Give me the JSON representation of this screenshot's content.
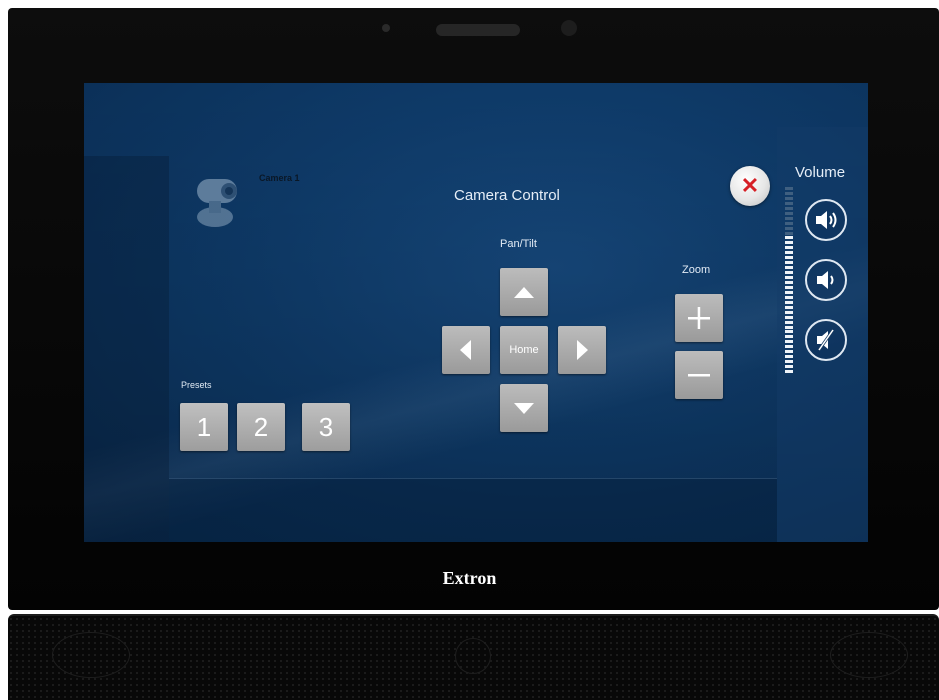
{
  "device": {
    "brand": "Extron"
  },
  "screen": {
    "camera_label": "Camera 1",
    "title": "Camera Control",
    "close_icon": "close-icon",
    "pan_tilt": {
      "label": "Pan/Tilt",
      "home_label": "Home"
    },
    "zoom": {
      "label": "Zoom"
    },
    "presets": {
      "label": "Presets",
      "items": [
        "1",
        "2",
        "3"
      ]
    },
    "volume": {
      "label": "Volume",
      "level": 0.73,
      "buttons": [
        "volume-up-icon",
        "volume-down-icon",
        "mute-icon"
      ]
    }
  },
  "colors": {
    "screen_bg": "#0e3a68",
    "button_gray": "#a8a8a8",
    "close_red": "#d61f26",
    "text": "#e6eef7"
  }
}
